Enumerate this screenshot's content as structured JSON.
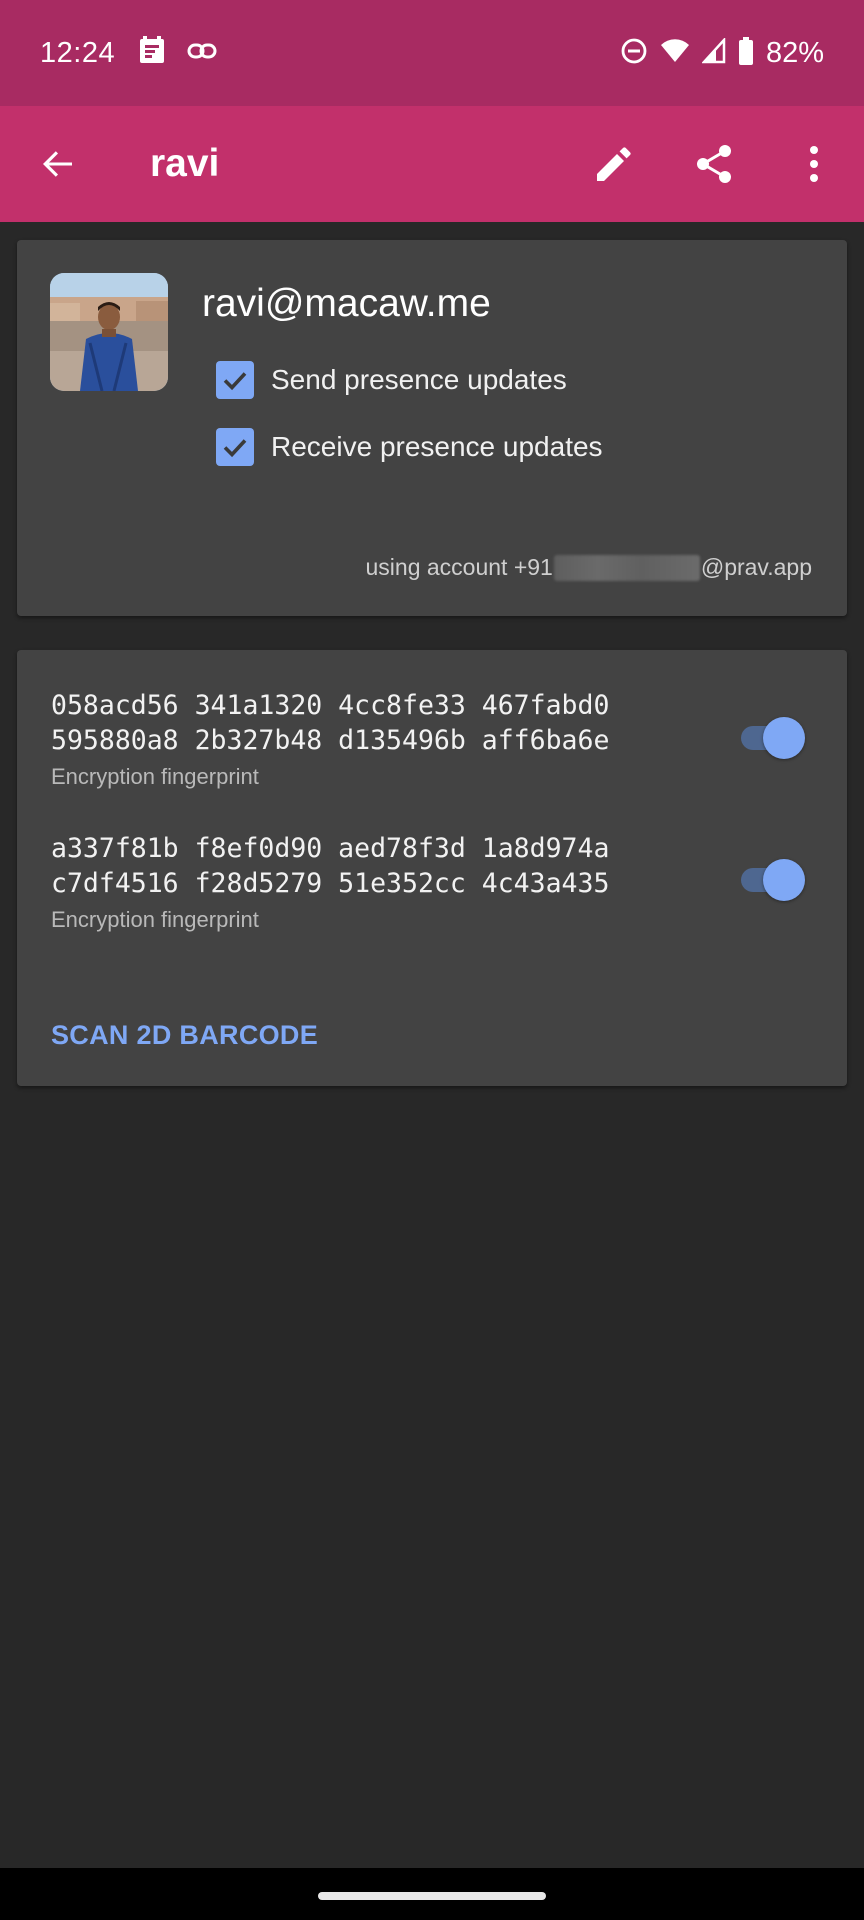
{
  "status_bar": {
    "time": "12:24",
    "battery_text": "82%",
    "icons": [
      "message-notification-icon",
      "link-icon",
      "do-not-disturb-icon",
      "wifi-icon",
      "cell-signal-icon",
      "battery-icon"
    ]
  },
  "app_bar": {
    "title": "ravi",
    "icons": [
      "back-arrow-icon",
      "edit-pencil-icon",
      "share-icon",
      "more-vert-icon"
    ]
  },
  "contact": {
    "jid": "ravi@macaw.me",
    "send_presence_label": "Send presence updates",
    "send_presence_checked": true,
    "receive_presence_label": "Receive presence updates",
    "receive_presence_checked": true,
    "account_prefix": "using account +91",
    "account_suffix": "@prav.app"
  },
  "fingerprints": [
    {
      "line1": "058acd56 341a1320 4cc8fe33 467fabd0",
      "line2": "595880a8 2b327b48 d135496b aff6ba6e",
      "caption": "Encryption fingerprint",
      "enabled": true
    },
    {
      "line1": "a337f81b f8ef0d90 aed78f3d 1a8d974a",
      "line2": "c7df4516 f28d5279 51e352cc 4c43a435",
      "caption": "Encryption fingerprint",
      "enabled": true
    }
  ],
  "scan_button_label": "SCAN 2D BARCODE",
  "colors": {
    "status_bar": "#a82b62",
    "app_bar": "#c2306b",
    "background": "#282828",
    "card": "#434343",
    "accent": "#7fa8f5"
  }
}
